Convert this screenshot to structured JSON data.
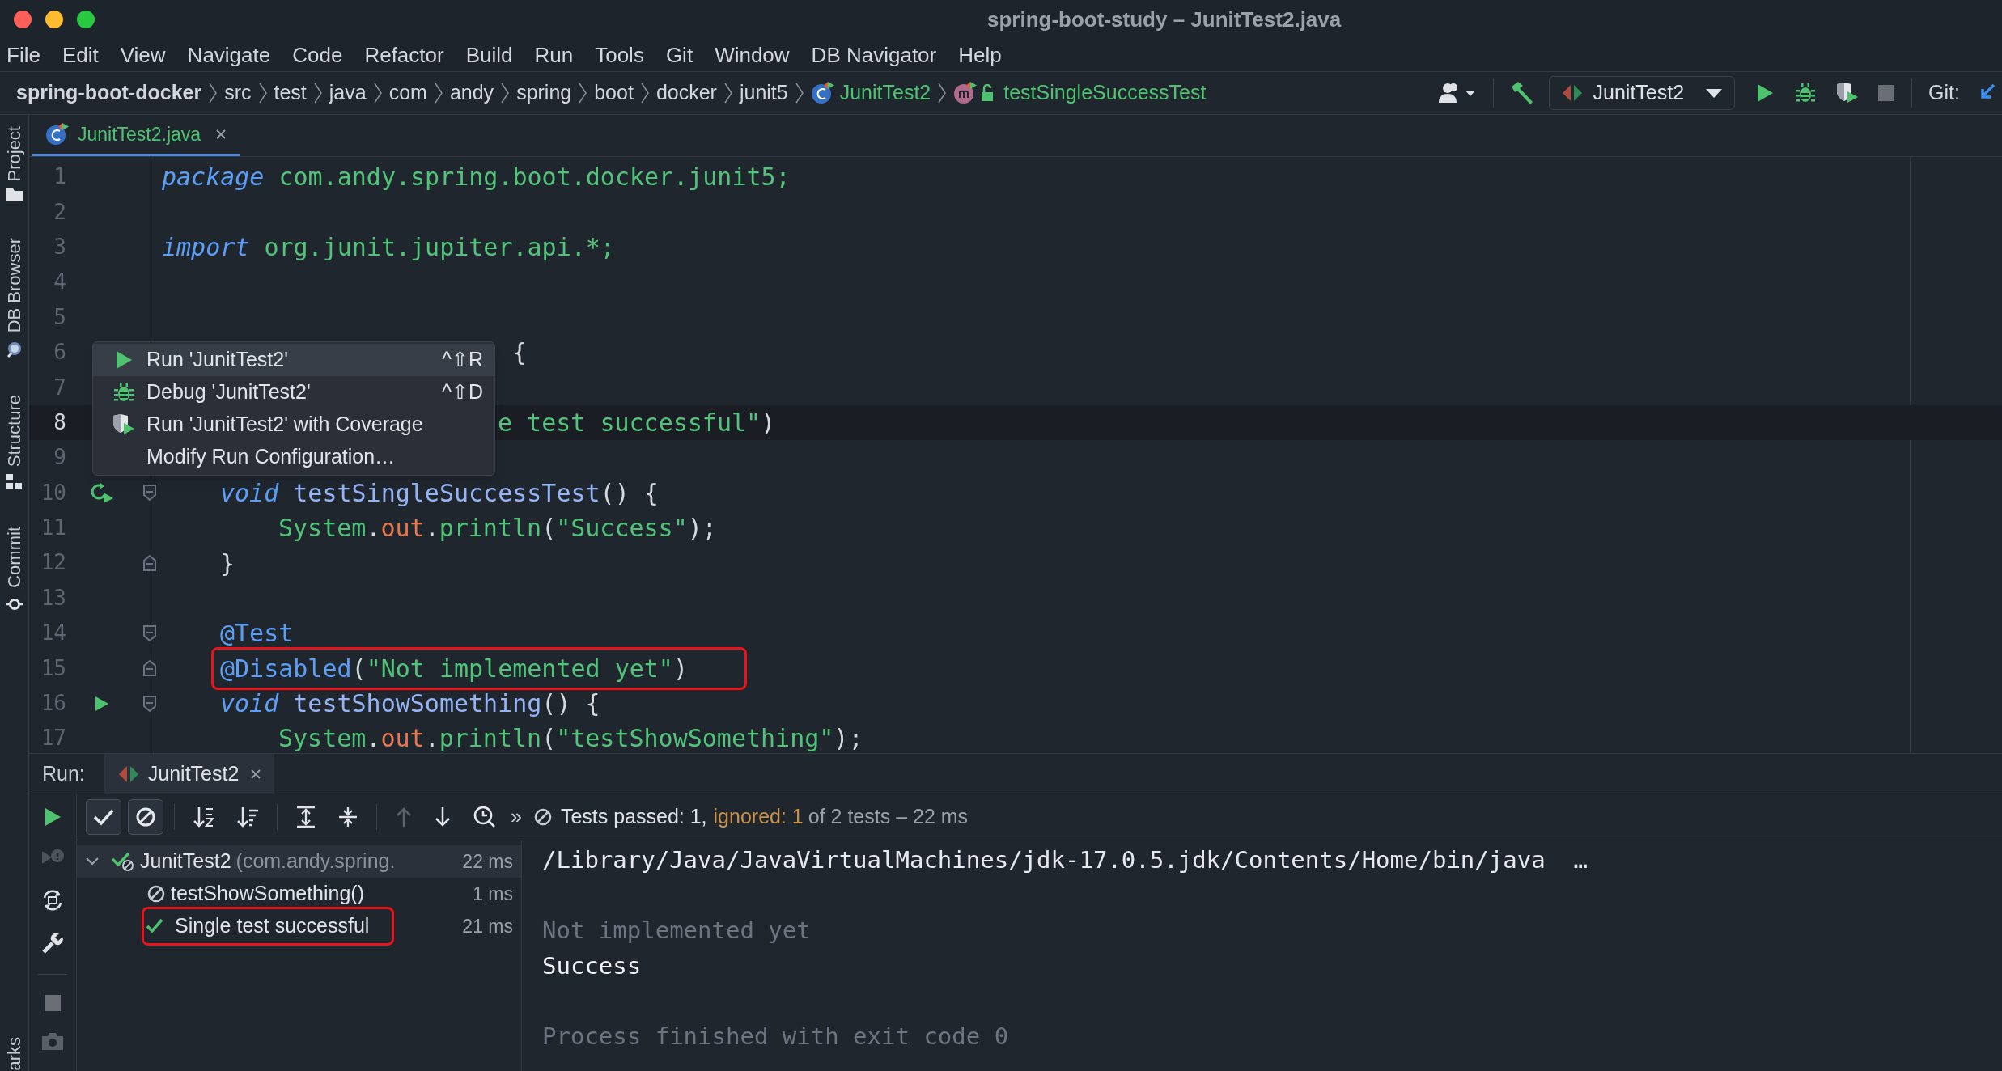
{
  "window": {
    "title": "spring-boot-study – JunitTest2.java"
  },
  "menu": [
    "File",
    "Edit",
    "View",
    "Navigate",
    "Code",
    "Refactor",
    "Build",
    "Run",
    "Tools",
    "Git",
    "Window",
    "DB Navigator",
    "Help"
  ],
  "breadcrumbs": [
    {
      "label": "spring-boot-docker",
      "kind": "project"
    },
    {
      "label": "src",
      "kind": "folder"
    },
    {
      "label": "test",
      "kind": "folder"
    },
    {
      "label": "java",
      "kind": "folder"
    },
    {
      "label": "com",
      "kind": "folder"
    },
    {
      "label": "andy",
      "kind": "folder"
    },
    {
      "label": "spring",
      "kind": "folder"
    },
    {
      "label": "boot",
      "kind": "folder"
    },
    {
      "label": "docker",
      "kind": "folder"
    },
    {
      "label": "junit5",
      "kind": "folder"
    },
    {
      "label": "JunitTest2",
      "kind": "class"
    },
    {
      "label": "testSingleSuccessTest",
      "kind": "method"
    }
  ],
  "toolbar": {
    "run_configuration": "JunitTest2",
    "git_label": "Git:"
  },
  "tool_windows": [
    {
      "label": "Project",
      "kind": "project"
    },
    {
      "label": "DB Browser",
      "kind": "db"
    },
    {
      "label": "Structure",
      "kind": "structure"
    },
    {
      "label": "Commit",
      "kind": "commit"
    },
    {
      "label": "arks",
      "kind": "bookmarks"
    }
  ],
  "editor": {
    "tabs": [
      {
        "label": "JunitTest2.java",
        "selected": true
      }
    ],
    "lines": [
      {
        "number": "1",
        "current": false,
        "tokens": [
          {
            "kind": "keyword",
            "text": "package"
          },
          {
            "kind": "package",
            "text": " com.andy.spring.boot.docker.junit5;"
          }
        ]
      },
      {
        "number": "2",
        "current": false
      },
      {
        "number": "3",
        "current": false,
        "tokens": [
          {
            "kind": "keyword",
            "text": "import"
          },
          {
            "kind": "package",
            "text": " org.junit.jupiter.api.*;"
          }
        ]
      },
      {
        "number": "4",
        "current": false
      },
      {
        "number": "5",
        "current": false
      },
      {
        "number": "6",
        "current": false,
        "indent": {
          "kind": "after_menu_wide"
        },
        "tokens": [
          {
            "kind": "plain",
            "text": "{"
          }
        ]
      },
      {
        "number": "7",
        "current": false
      },
      {
        "number": "8",
        "current": true,
        "indent": {
          "kind": "after_menu"
        },
        "tokens": [
          {
            "kind": "string",
            "text": "e test successful\""
          },
          {
            "kind": "plain",
            "text": ")"
          }
        ]
      },
      {
        "number": "9",
        "current": false
      },
      {
        "number": "10",
        "current": false,
        "fold": {
          "kind": "start"
        },
        "gutter": {
          "kind": "rerun"
        },
        "indent": {
          "kind": "member"
        },
        "tokens": [
          {
            "kind": "keyword",
            "text": "void"
          },
          {
            "kind": "method",
            "text": " testSingleSuccessTest"
          },
          {
            "kind": "plain",
            "text": "() {"
          }
        ]
      },
      {
        "number": "11",
        "current": false,
        "indent": {
          "kind": "statement"
        },
        "tokens": [
          {
            "kind": "name",
            "text": "System"
          },
          {
            "kind": "plain",
            "text": "."
          },
          {
            "kind": "field",
            "text": "out"
          },
          {
            "kind": "plain",
            "text": "."
          },
          {
            "kind": "name",
            "text": "println"
          },
          {
            "kind": "plain",
            "text": "("
          },
          {
            "kind": "string",
            "text": "\"Success\""
          },
          {
            "kind": "plain",
            "text": ");"
          }
        ]
      },
      {
        "number": "12",
        "current": false,
        "fold": {
          "kind": "end"
        },
        "indent": {
          "kind": "member"
        },
        "tokens": [
          {
            "kind": "plain",
            "text": "}"
          }
        ]
      },
      {
        "number": "13",
        "current": false
      },
      {
        "number": "14",
        "current": false,
        "fold": {
          "kind": "start"
        },
        "indent": {
          "kind": "member"
        },
        "tokens": [
          {
            "kind": "annotation",
            "text": "@Test"
          }
        ]
      },
      {
        "number": "15",
        "current": false,
        "fold": {
          "kind": "end"
        },
        "highlighted": true,
        "indent": {
          "kind": "member"
        },
        "tokens": [
          {
            "kind": "annotation",
            "text": "@Disabled"
          },
          {
            "kind": "plain",
            "text": "("
          },
          {
            "kind": "string",
            "text": "\"Not implemented yet\""
          },
          {
            "kind": "plain",
            "text": ")"
          }
        ]
      },
      {
        "number": "16",
        "current": false,
        "fold": {
          "kind": "start"
        },
        "gutter": {
          "kind": "run"
        },
        "indent": {
          "kind": "member"
        },
        "tokens": [
          {
            "kind": "keyword",
            "text": "void"
          },
          {
            "kind": "method",
            "text": " testShowSomething"
          },
          {
            "kind": "plain",
            "text": "() {"
          }
        ]
      },
      {
        "number": "17",
        "current": false,
        "indent": {
          "kind": "statement"
        },
        "tokens": [
          {
            "kind": "name",
            "text": "System"
          },
          {
            "kind": "plain",
            "text": "."
          },
          {
            "kind": "field",
            "text": "out"
          },
          {
            "kind": "plain",
            "text": "."
          },
          {
            "kind": "name",
            "text": "println"
          },
          {
            "kind": "plain",
            "text": "("
          },
          {
            "kind": "string",
            "text": "\"testShowSomething\""
          },
          {
            "kind": "plain",
            "text": ");"
          }
        ]
      }
    ]
  },
  "context_menu": {
    "items": [
      {
        "label": "Run 'JunitTest2'",
        "shortcut": "^⇧R",
        "kind": "run",
        "selected": true
      },
      {
        "label": "Debug 'JunitTest2'",
        "shortcut": "^⇧D",
        "kind": "debug",
        "selected": false
      },
      {
        "label": "Run 'JunitTest2' with Coverage",
        "kind": "coverage",
        "selected": false
      },
      {
        "label": "Modify Run Configuration…",
        "kind": "plain",
        "selected": false
      }
    ]
  },
  "run_panel": {
    "label": "Run:",
    "tabs": [
      {
        "label": "JunitTest2",
        "selected": true
      }
    ],
    "filters": [
      {
        "kind": "passed",
        "on": true
      },
      {
        "kind": "ignored",
        "on": true
      }
    ],
    "more": "»",
    "status": {
      "passed": "Tests passed: 1,",
      "ignored": "ignored: 1",
      "summary": "of 2 tests – 22 ms"
    },
    "tree": [
      {
        "label": "JunitTest2",
        "detail": "(com.andy.spring.",
        "time": "22 ms",
        "kind": "mixed",
        "expanded": true,
        "selected": true,
        "highlighted": false,
        "children": [
          {
            "label": "testShowSomething()",
            "time": "1 ms",
            "kind": "ignored",
            "selected": false,
            "highlighted": false
          },
          {
            "label": "Single test successful",
            "time": "21 ms",
            "kind": "passed",
            "selected": false,
            "highlighted": true
          }
        ]
      }
    ],
    "console": [
      {
        "kind": "command",
        "text": "/Library/Java/JavaVirtualMachines/jdk-17.0.5.jdk/Contents/Home/bin/java  …"
      },
      {
        "kind": "blank"
      },
      {
        "kind": "system",
        "text": "Not implemented yet"
      },
      {
        "kind": "output",
        "text": "Success"
      },
      {
        "kind": "blank"
      },
      {
        "kind": "system",
        "text": "Process finished with exit code 0"
      }
    ]
  }
}
